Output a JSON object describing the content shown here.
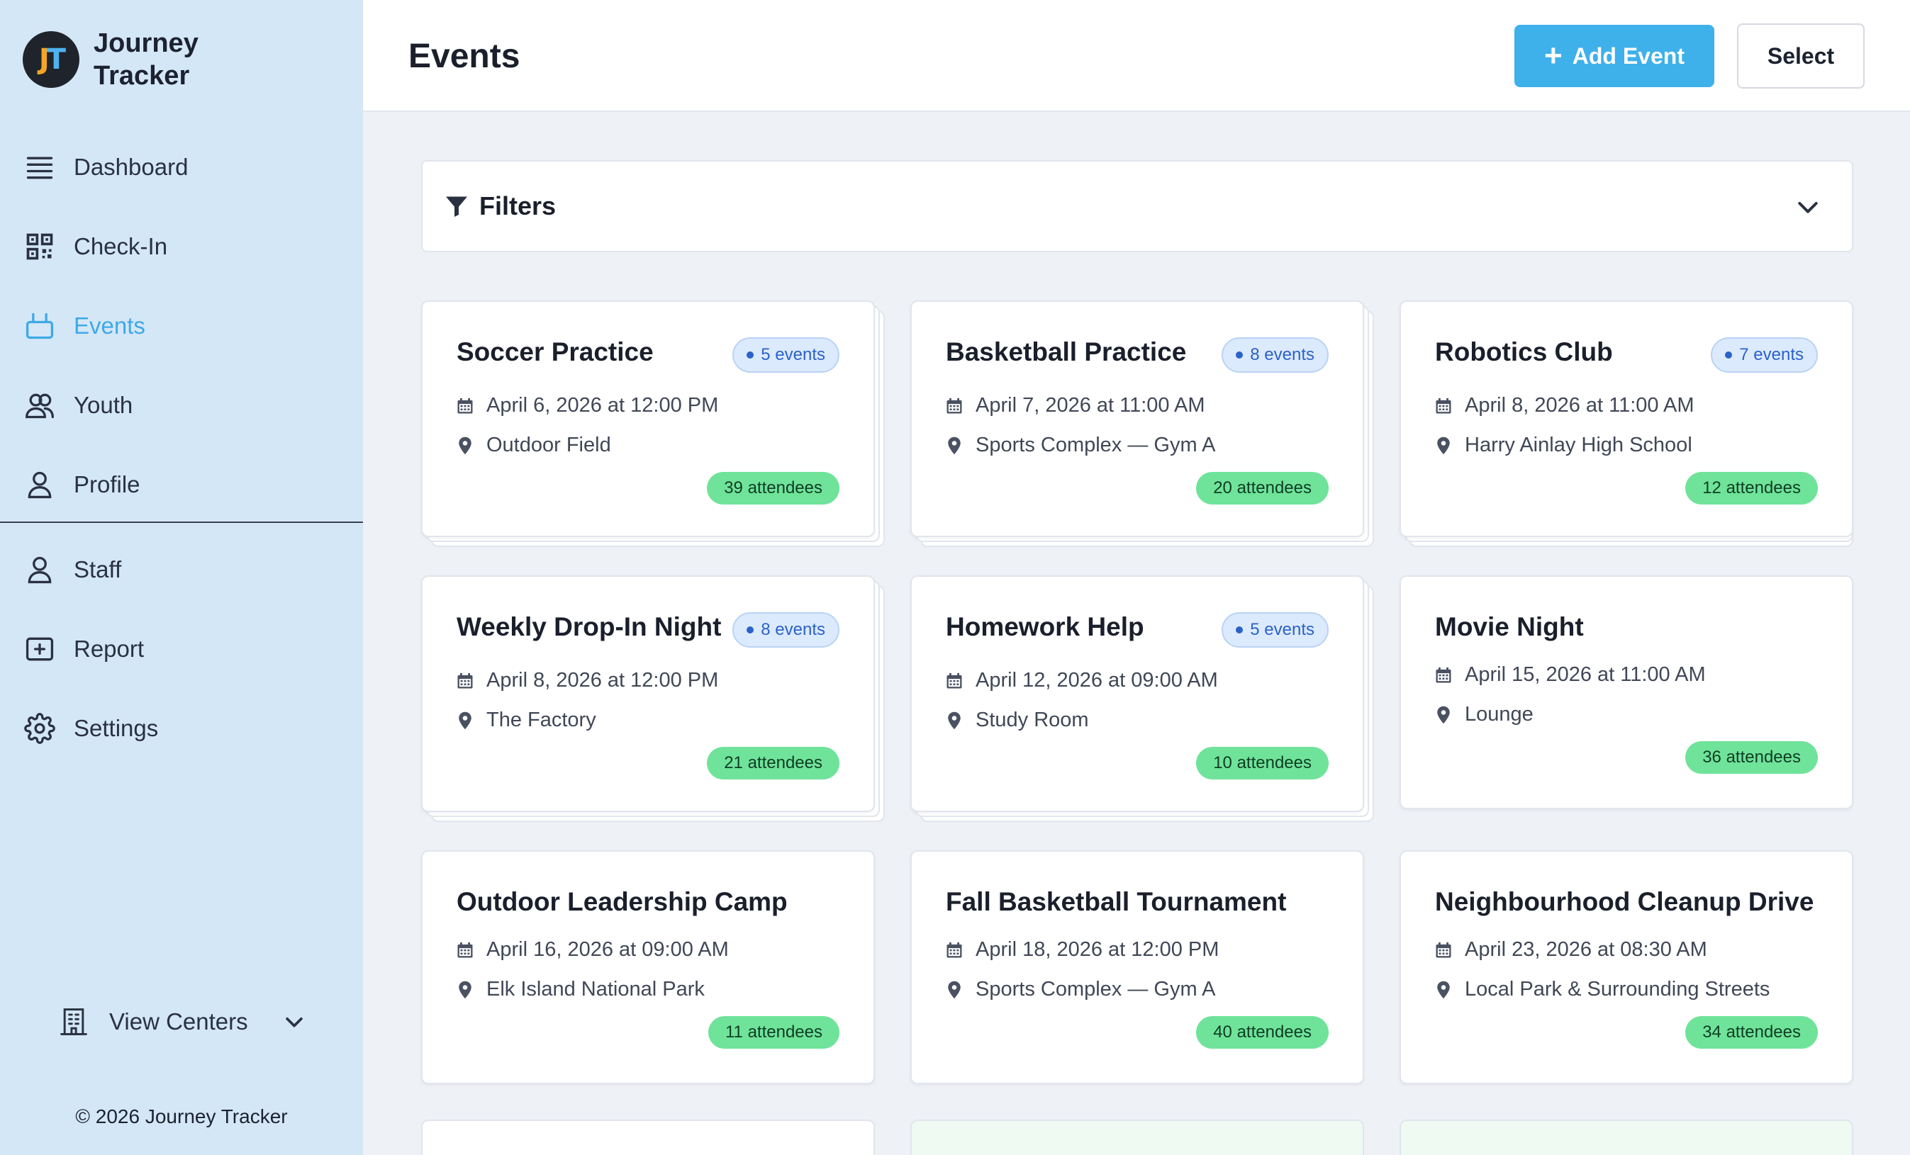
{
  "brand": {
    "logo_text": "JT",
    "name": "Journey Tracker"
  },
  "sidebar": {
    "items": [
      {
        "label": "Dashboard",
        "icon": "menu-icon"
      },
      {
        "label": "Check-In",
        "icon": "qr-code-icon"
      },
      {
        "label": "Events",
        "icon": "tv-icon",
        "active": true
      },
      {
        "label": "Youth",
        "icon": "users-icon"
      },
      {
        "label": "Profile",
        "icon": "user-icon"
      }
    ],
    "admin_items": [
      {
        "label": "Staff",
        "icon": "user-icon"
      },
      {
        "label": "Report",
        "icon": "plus-square-icon"
      },
      {
        "label": "Settings",
        "icon": "gear-icon"
      }
    ],
    "centers_label": "View Centers",
    "copyright": "© 2026 Journey Tracker"
  },
  "header": {
    "title": "Events",
    "add_label": "Add Event",
    "select_label": "Select"
  },
  "filters": {
    "label": "Filters"
  },
  "colors": {
    "accent": "#3eb0ea",
    "sidebar_bg": "#d4e7f7",
    "attendee_badge": "#6fe39a",
    "events_badge": "#dceafd"
  },
  "events": [
    {
      "title": "Soccer Practice",
      "series": "5 events",
      "date": "April 6, 2026 at 12:00 PM",
      "location": "Outdoor Field",
      "attendees": "39 attendees"
    },
    {
      "title": "Basketball Practice",
      "series": "8 events",
      "date": "April 7, 2026 at 11:00 AM",
      "location": "Sports Complex — Gym A",
      "attendees": "20 attendees"
    },
    {
      "title": "Robotics Club",
      "series": "7 events",
      "date": "April 8, 2026 at 11:00 AM",
      "location": "Harry Ainlay High School",
      "attendees": "12 attendees"
    },
    {
      "title": "Weekly Drop-In Night",
      "series": "8 events",
      "date": "April 8, 2026 at 12:00 PM",
      "location": "The Factory",
      "attendees": "21 attendees"
    },
    {
      "title": "Homework Help",
      "series": "5 events",
      "date": "April 12, 2026 at 09:00 AM",
      "location": "Study Room",
      "attendees": "10 attendees"
    },
    {
      "title": "Movie Night",
      "series": "",
      "date": "April 15, 2026 at 11:00 AM",
      "location": "Lounge",
      "attendees": "36 attendees"
    },
    {
      "title": "Outdoor Leadership Camp",
      "series": "",
      "date": "April 16, 2026 at 09:00 AM",
      "location": "Elk Island National Park",
      "attendees": "11 attendees"
    },
    {
      "title": "Fall Basketball Tournament",
      "series": "",
      "date": "April 18, 2026 at 12:00 PM",
      "location": "Sports Complex — Gym A",
      "attendees": "40 attendees"
    },
    {
      "title": "Neighbourhood Cleanup Drive",
      "series": "",
      "date": "April 23, 2026 at 08:30 AM",
      "location": "Local Park & Surrounding Streets",
      "attendees": "34 attendees"
    }
  ]
}
